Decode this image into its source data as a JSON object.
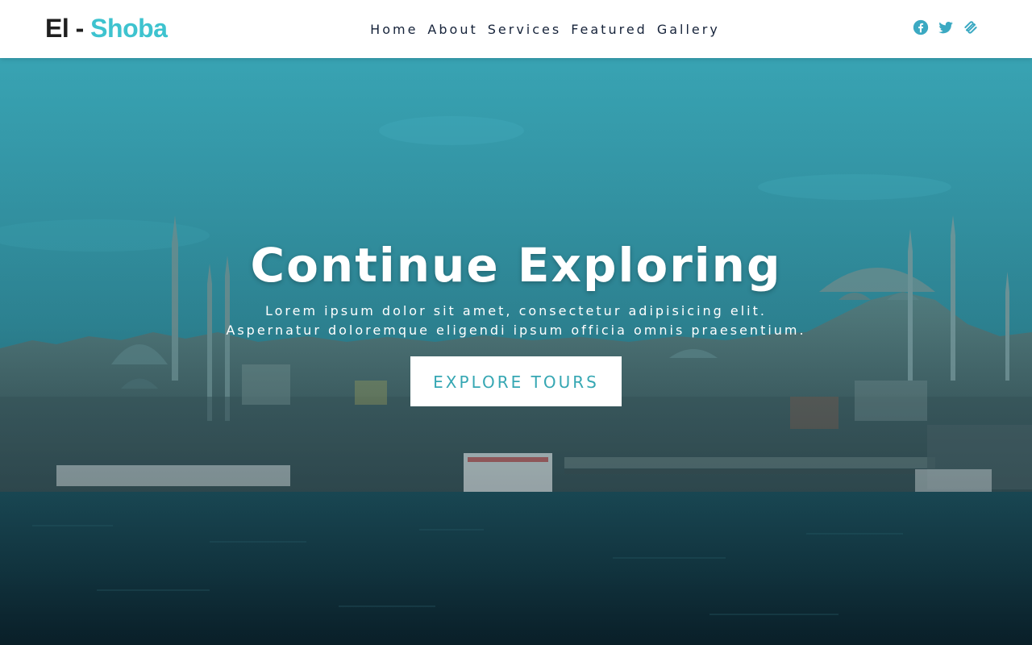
{
  "brand": {
    "part1": "El - ",
    "part2": "Shoba",
    "accent_color": "#3ec3cf"
  },
  "nav": {
    "items": [
      {
        "label": "Home"
      },
      {
        "label": "About"
      },
      {
        "label": "Services"
      },
      {
        "label": "Featured"
      },
      {
        "label": "Gallery"
      }
    ]
  },
  "social": {
    "icons": [
      "facebook-icon",
      "twitter-icon",
      "squarespace-icon"
    ],
    "color": "#3ba9c2"
  },
  "hero": {
    "title": "Continue Exploring",
    "subtitle_line1": "Lorem ipsum dolor sit amet, consectetur adipisicing elit.",
    "subtitle_line2": "Aspernatur doloremque eligendi ipsum officia omnis praesentium.",
    "button_label": "EXPLORE TOURS",
    "button_text_color": "#36a7b3"
  }
}
